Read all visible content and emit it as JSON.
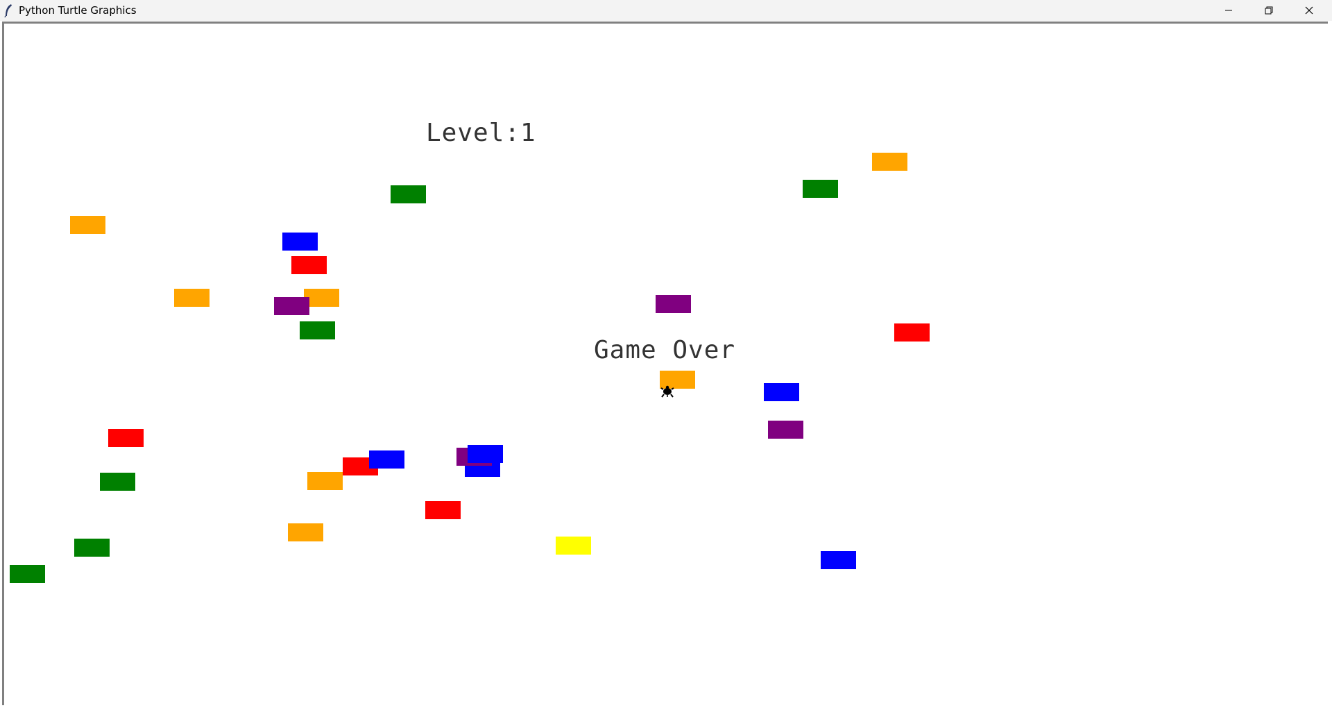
{
  "window": {
    "title": "Python Turtle Graphics",
    "controls": [
      "minimize",
      "restore",
      "close"
    ]
  },
  "hud": {
    "level_text": "Level:1",
    "status_text": "Game Over"
  },
  "colors": {
    "orange": "#ffa500",
    "green": "#008000",
    "blue": "#0000ff",
    "red": "#ff0000",
    "purple": "#800080",
    "yellow": "#ffff00",
    "player": "#000000",
    "text": "#333333"
  },
  "player": {
    "icon": "turtle-icon",
    "color": "black"
  },
  "cars": [
    "orange",
    "green",
    "orange",
    "green",
    "blue",
    "red",
    "orange",
    "orange",
    "purple",
    "purple",
    "green",
    "red",
    "red",
    "blue",
    "green",
    "red",
    "blue",
    "purple",
    "blue",
    "orange",
    "orange",
    "blue",
    "red",
    "purple",
    "yellow",
    "green",
    "blue",
    "orange",
    "green"
  ]
}
